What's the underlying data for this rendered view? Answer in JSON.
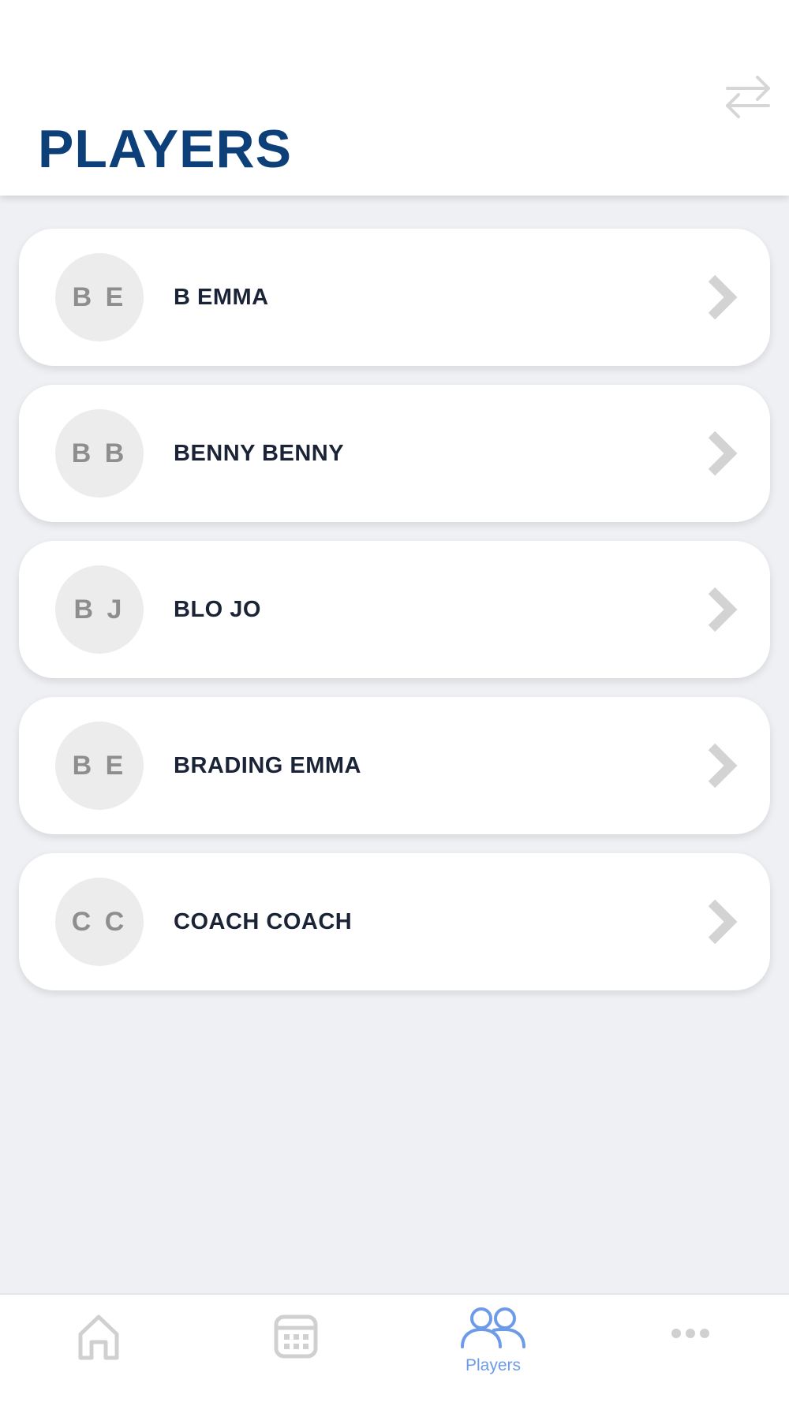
{
  "header": {
    "title": "PLAYERS",
    "swap_icon": "swap-arrows-icon"
  },
  "players": [
    {
      "initials": "B E",
      "name": "B EMMA"
    },
    {
      "initials": "B B",
      "name": "BENNY BENNY"
    },
    {
      "initials": "B J",
      "name": "BLO JO"
    },
    {
      "initials": "B E",
      "name": "BRADING EMMA"
    },
    {
      "initials": "C C",
      "name": "COACH COACH"
    }
  ],
  "nav": {
    "items": [
      {
        "icon": "home-icon",
        "label": ""
      },
      {
        "icon": "calendar-icon",
        "label": ""
      },
      {
        "icon": "players-icon",
        "label": "Players",
        "active": true
      },
      {
        "icon": "more-icon",
        "label": ""
      }
    ]
  },
  "colors": {
    "title": "#0d3f78",
    "active_nav": "#6d9be8",
    "inactive_icon": "#d0d0d0",
    "background": "#eef0f4"
  }
}
